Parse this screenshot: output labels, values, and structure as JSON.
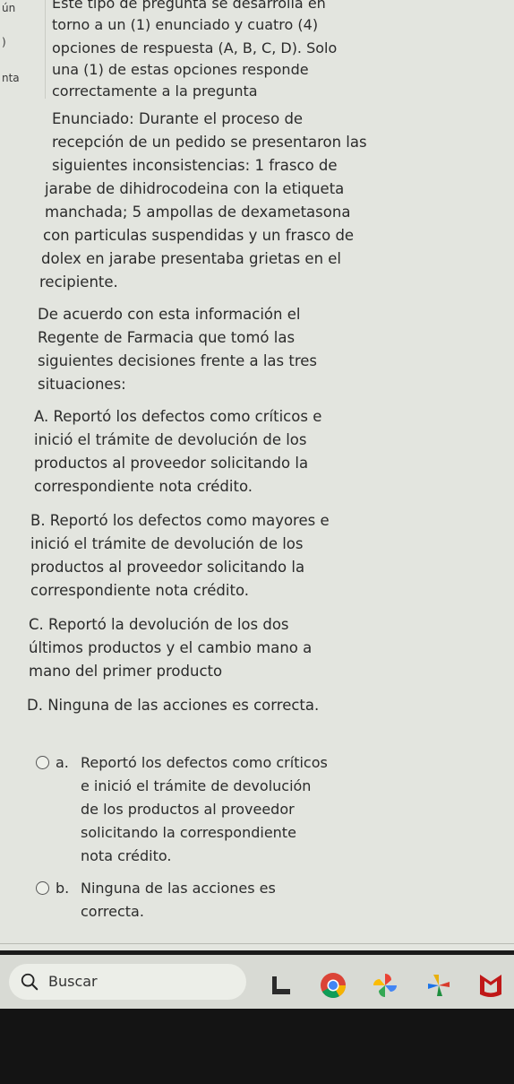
{
  "intro": {
    "lines": [
      "Este tipo de pregunta se desarrolla en",
      "torno a un (1) enunciado y cuatro (4)",
      "opciones de respuesta (A, B, C, D). Solo",
      "una (1) de estas opciones responde",
      "correctamente a la pregunta"
    ]
  },
  "left_strip": {
    "lines": [
      "ún",
      ")",
      "nta"
    ]
  },
  "statement": {
    "lines": [
      "Enunciado: Durante el proceso de",
      "recepción de un pedido se presentaron las",
      "siguientes inconsistencias: 1 frasco de",
      "jarabe de dihidrocodeina con la etiqueta",
      "manchada; 5 ampollas de dexametasona",
      "con particulas suspendidas y un frasco de",
      "dolex en jarabe presentaba grietas en el",
      "recipiente."
    ]
  },
  "context": {
    "lines": [
      "De acuerdo con esta información el",
      "Regente de Farmacia que tomó las",
      "siguientes decisiones frente a las tres",
      "situaciones:"
    ]
  },
  "options": [
    {
      "lines": [
        "A. Reportó los defectos como críticos e",
        "inició el trámite de devolución de los",
        "productos al proveedor solicitando la",
        "correspondiente nota crédito."
      ]
    },
    {
      "lines": [
        "B. Reportó los defectos como mayores e",
        "inició el trámite de devolución de los",
        "productos al proveedor solicitando la",
        "correspondiente nota crédito."
      ]
    },
    {
      "lines": [
        "C. Reportó la devolución de los dos",
        "últimos productos y el cambio mano a",
        "mano del primer producto"
      ]
    },
    {
      "lines": [
        "D. Ninguna de las acciones es correcta."
      ]
    }
  ],
  "answers": [
    {
      "letter": "a.",
      "lines": [
        "Reportó los defectos como críticos",
        "e inició el trámite de devolución",
        "de los productos al proveedor",
        "solicitando la correspondiente",
        "nota crédito."
      ]
    },
    {
      "letter": "b.",
      "lines": [
        "Ninguna de las acciones es",
        "correcta."
      ]
    }
  ],
  "taskbar": {
    "search_label": "Buscar"
  },
  "colors": {
    "screen_bg": "#e3e5df",
    "taskbar_bg": "#d8dad4"
  }
}
